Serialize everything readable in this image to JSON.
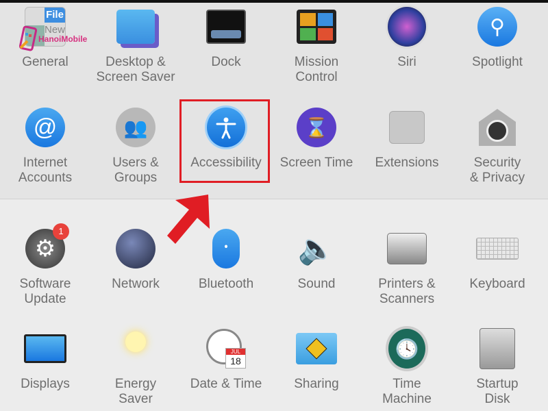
{
  "rows": [
    [
      {
        "label": "General",
        "icon": "general-icon"
      },
      {
        "label": "Desktop &\nScreen Saver",
        "icon": "desktop-screensaver-icon"
      },
      {
        "label": "Dock",
        "icon": "dock-icon"
      },
      {
        "label": "Mission\nControl",
        "icon": "mission-control-icon"
      },
      {
        "label": "Siri",
        "icon": "siri-icon"
      },
      {
        "label": "Spotlight",
        "icon": "spotlight-icon"
      }
    ],
    [
      {
        "label": "Internet\nAccounts",
        "icon": "internet-accounts-icon"
      },
      {
        "label": "Users &\nGroups",
        "icon": "users-groups-icon"
      },
      {
        "label": "Accessibility",
        "icon": "accessibility-icon"
      },
      {
        "label": "Screen Time",
        "icon": "screen-time-icon"
      },
      {
        "label": "Extensions",
        "icon": "extensions-icon"
      },
      {
        "label": "Security\n& Privacy",
        "icon": "security-privacy-icon"
      }
    ],
    [
      {
        "label": "Software\nUpdate",
        "icon": "software-update-icon",
        "badge": "1"
      },
      {
        "label": "Network",
        "icon": "network-icon"
      },
      {
        "label": "Bluetooth",
        "icon": "bluetooth-icon"
      },
      {
        "label": "Sound",
        "icon": "sound-icon"
      },
      {
        "label": "Printers &\nScanners",
        "icon": "printers-scanners-icon"
      },
      {
        "label": "Keyboard",
        "icon": "keyboard-icon"
      }
    ],
    [
      {
        "label": "Displays",
        "icon": "displays-icon"
      },
      {
        "label": "Energy\nSaver",
        "icon": "energy-saver-icon"
      },
      {
        "label": "Date & Time",
        "icon": "date-time-icon",
        "calendar_month": "JUL",
        "calendar_day": "18"
      },
      {
        "label": "Sharing",
        "icon": "sharing-icon"
      },
      {
        "label": "Time\nMachine",
        "icon": "time-machine-icon"
      },
      {
        "label": "Startup\nDisk",
        "icon": "startup-disk-icon"
      }
    ]
  ],
  "general_icon_text": {
    "line1": "File",
    "line2": "New"
  },
  "watermark": "HanoiMobile",
  "highlight_color": "#e01d24"
}
